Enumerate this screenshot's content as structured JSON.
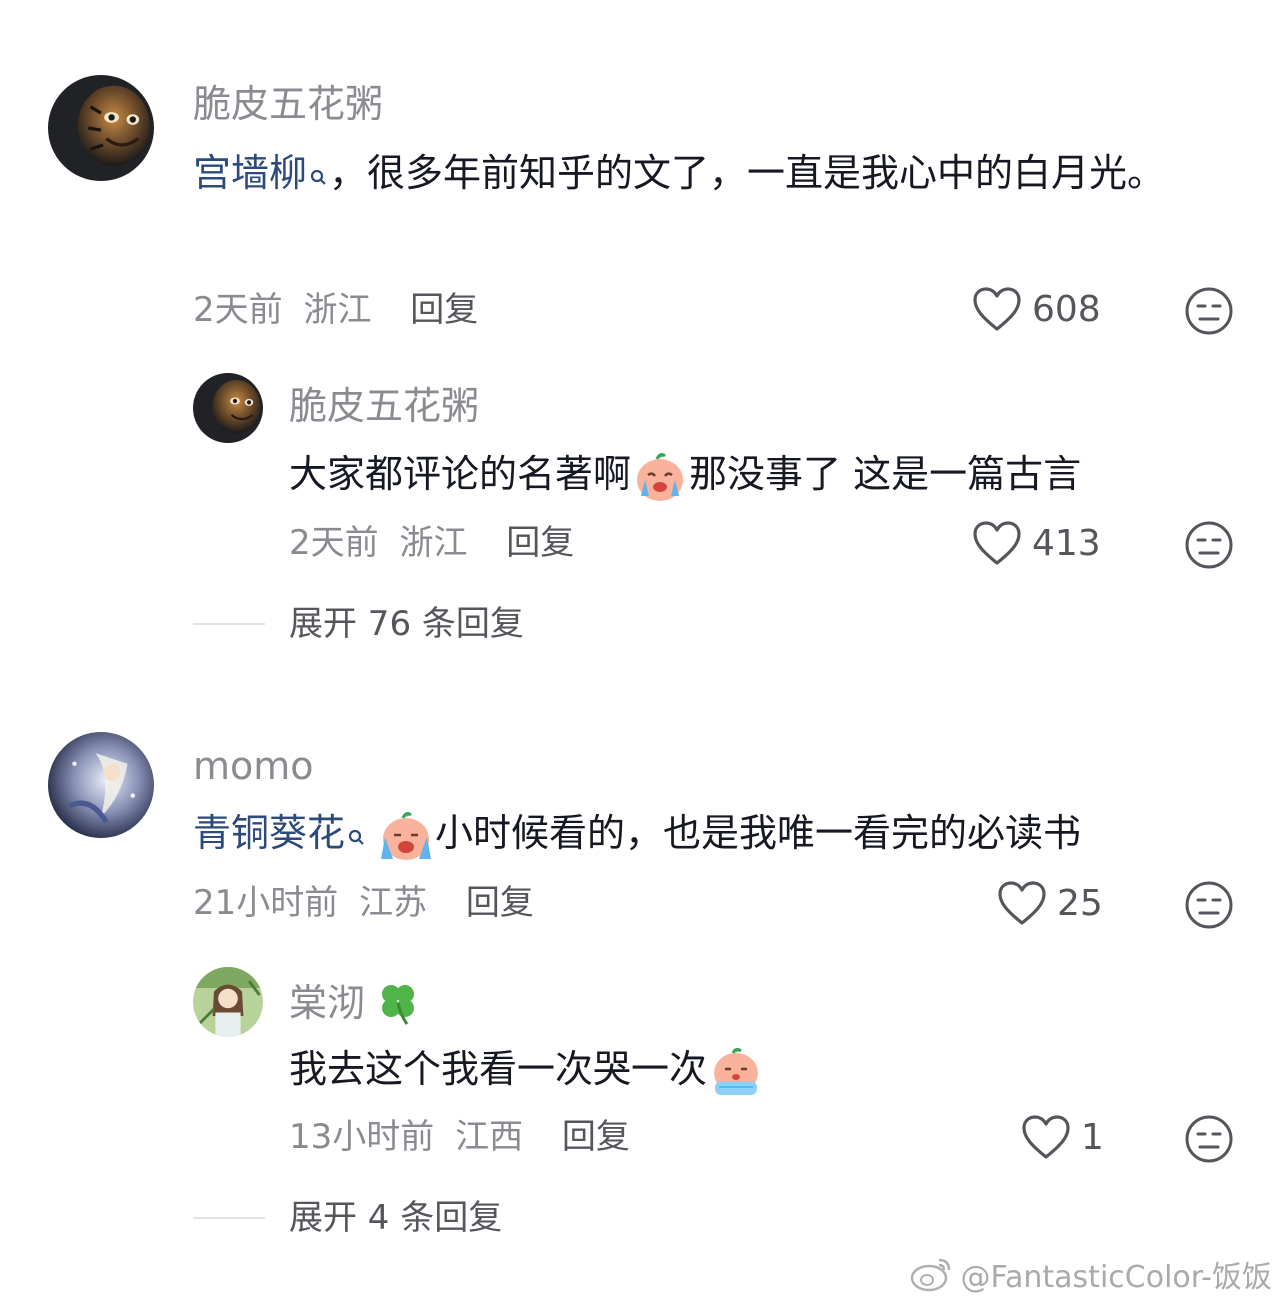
{
  "comments": [
    {
      "username": "脆皮五花粥",
      "mention": "宫墙柳",
      "text": "，很多年前知乎的文了，一直是我心中的白月光。",
      "time": "2天前",
      "location": "浙江",
      "reply_label": "回复",
      "likes": "608",
      "reply": {
        "username": "脆皮五花粥",
        "text_before": "大家都评论的名著啊",
        "text_after": "那没事了 这是一篇古言",
        "time": "2天前",
        "location": "浙江",
        "reply_label": "回复",
        "likes": "413"
      },
      "expand_label": "展开 76 条回复"
    },
    {
      "username": "momo",
      "mention": "青铜葵花",
      "text": "小时候看的，也是我唯一看完的必读书",
      "time": "21小时前",
      "location": "江苏",
      "reply_label": "回复",
      "likes": "25",
      "reply": {
        "username": "棠沏",
        "text": "我去这个我看一次哭一次",
        "time": "13小时前",
        "location": "江西",
        "reply_label": "回复",
        "likes": "1"
      },
      "expand_label": "展开 4 条回复"
    }
  ],
  "watermark": "@FantasticColor-饭饭",
  "icons": {
    "like": "heart-outline-icon",
    "dislike": "meh-face-icon",
    "search": "search-mark-icon",
    "clover": "four-leaf-clover-icon",
    "weibo": "weibo-logo-icon"
  },
  "colors": {
    "text": "#161823",
    "muted": "#8a8b91",
    "link": "#2c4a7c"
  }
}
